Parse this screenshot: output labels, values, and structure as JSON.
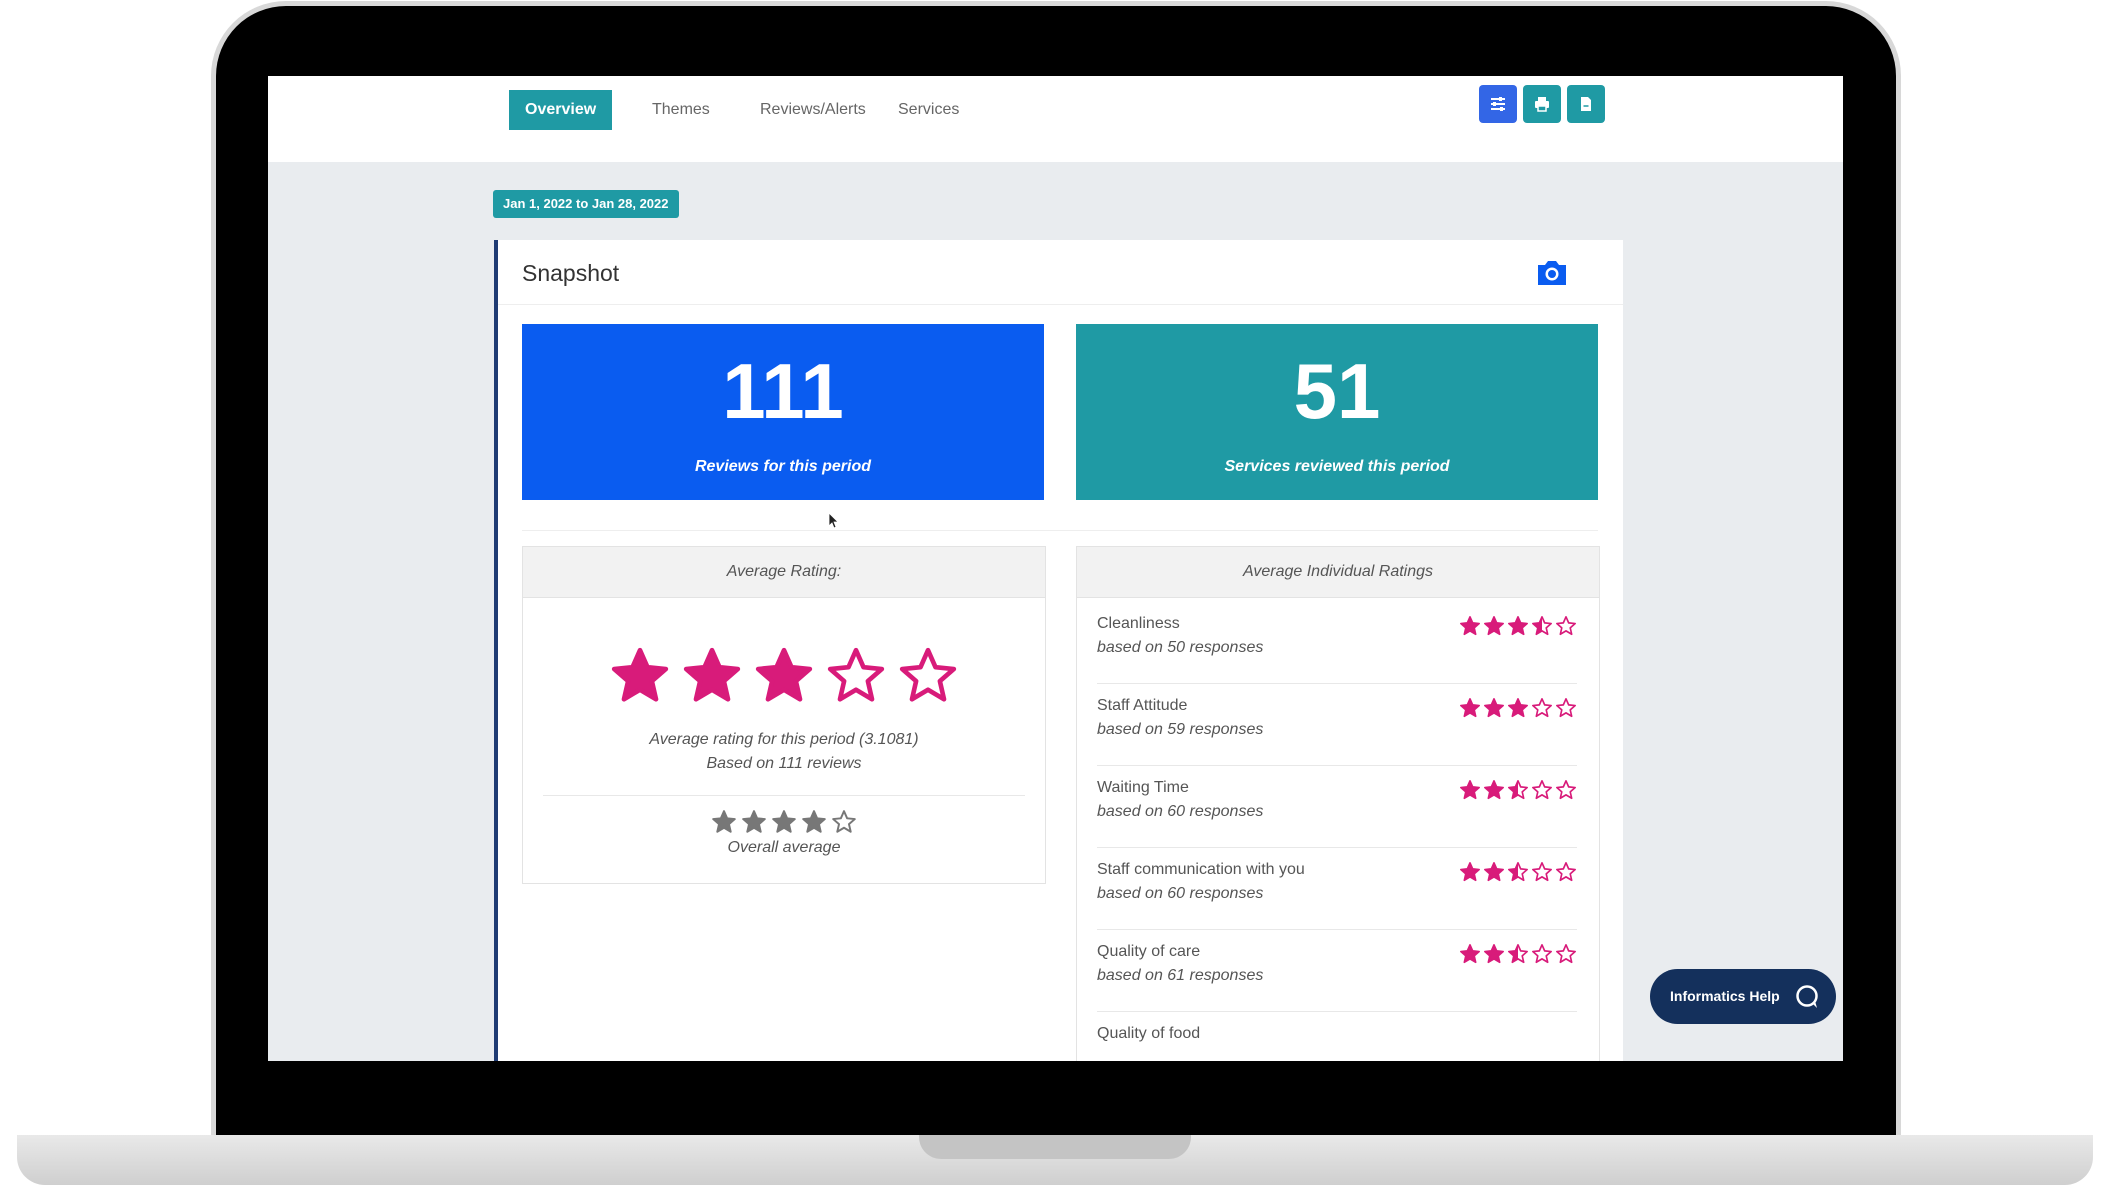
{
  "tabs": [
    {
      "label": "Overview",
      "active": true
    },
    {
      "label": "Themes",
      "active": false
    },
    {
      "label": "Reviews/Alerts",
      "active": false
    },
    {
      "label": "Services",
      "active": false
    }
  ],
  "toolbar": {
    "buttons": [
      {
        "icon": "sliders-icon",
        "color": "#3366e6"
      },
      {
        "icon": "printer-icon",
        "color": "#1f9aa4"
      },
      {
        "icon": "document-icon",
        "color": "#1f9aa4"
      }
    ]
  },
  "date_range": "Jan 1, 2022 to Jan 28, 2022",
  "snapshot": {
    "title": "Snapshot",
    "camera_icon": "camera-icon",
    "reviews": {
      "value": "111",
      "label": "Reviews for this period",
      "color": "#0a5cf0"
    },
    "services": {
      "value": "51",
      "label": "Services reviewed this period",
      "color": "#1f9aa4"
    }
  },
  "average_rating": {
    "header": "Average Rating:",
    "stars_filled": 3,
    "stars_total": 5,
    "line": "Average rating for this period (3.1081)",
    "based_on": "Based on 111 reviews",
    "overall_stars_filled": 4,
    "overall_label": "Overall average"
  },
  "individual": {
    "header": "Average Individual Ratings",
    "items": [
      {
        "name": "Cleanliness",
        "sub": "based on 50 responses",
        "rating": 3.5
      },
      {
        "name": "Staff Attitude",
        "sub": "based on 59 responses",
        "rating": 3
      },
      {
        "name": "Waiting Time",
        "sub": "based on 60 responses",
        "rating": 2.5
      },
      {
        "name": "Staff communication with you",
        "sub": "based on 60 responses",
        "rating": 2.5
      },
      {
        "name": "Quality of care",
        "sub": "based on 61 responses",
        "rating": 2.5
      },
      {
        "name": "Quality of food",
        "sub": "",
        "rating": 0
      }
    ]
  },
  "help": {
    "label": "Informatics Help",
    "icon": "chat-bubble-icon"
  },
  "colors": {
    "accent": "#1f9aa4",
    "star": "#d81b7a",
    "navy": "#14305c"
  }
}
